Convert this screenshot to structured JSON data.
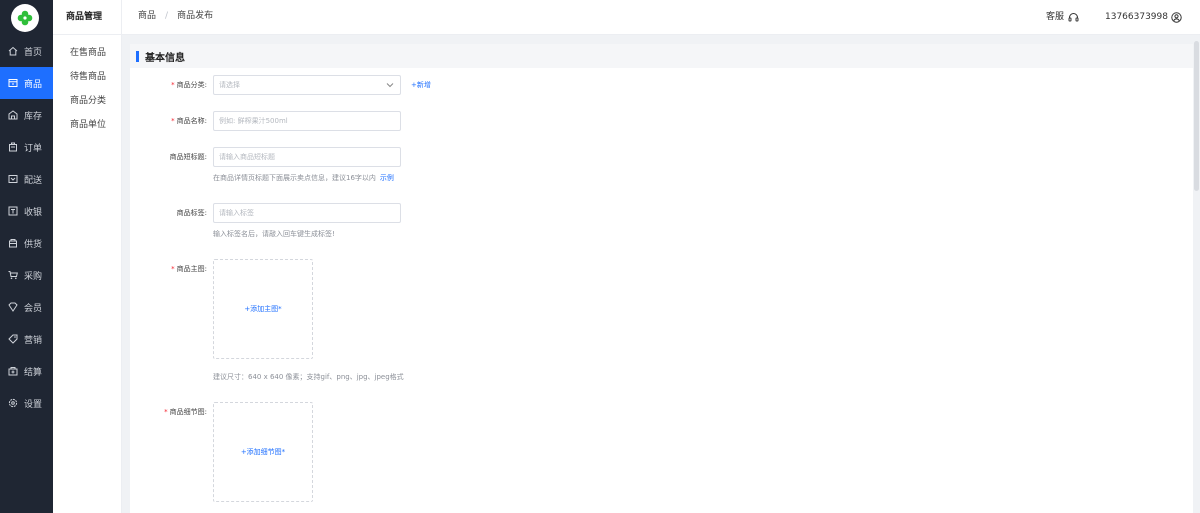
{
  "sidebar": {
    "items": [
      {
        "label": "首页",
        "icon": "home-icon"
      },
      {
        "label": "商品",
        "icon": "goods-icon",
        "active": true
      },
      {
        "label": "库存",
        "icon": "warehouse-icon"
      },
      {
        "label": "订单",
        "icon": "order-icon"
      },
      {
        "label": "配送",
        "icon": "delivery-icon"
      },
      {
        "label": "收银",
        "icon": "cashier-icon"
      },
      {
        "label": "供货",
        "icon": "supply-icon"
      },
      {
        "label": "采购",
        "icon": "cart-icon"
      },
      {
        "label": "会员",
        "icon": "member-icon"
      },
      {
        "label": "营销",
        "icon": "tag-icon"
      },
      {
        "label": "结算",
        "icon": "settlement-icon"
      },
      {
        "label": "设置",
        "icon": "gear-icon"
      }
    ]
  },
  "submenu": {
    "title": "商品管理",
    "items": [
      "在售商品",
      "待售商品",
      "商品分类",
      "商品单位"
    ]
  },
  "header": {
    "breadcrumb": [
      "商品",
      "商品发布"
    ],
    "service_label": "客服",
    "phone": "13766373998"
  },
  "form": {
    "section_title": "基本信息",
    "category": {
      "label": "商品分类:",
      "placeholder": "请选择",
      "add_link": "+新增"
    },
    "name": {
      "label": "商品名称:",
      "placeholder": "例如: 鲜榨果汁500ml"
    },
    "short_title": {
      "label": "商品短标题:",
      "placeholder": "请输入商品短标题",
      "hint": "在商品详情页标题下面展示卖点信息，建议16字以内",
      "hint_link": "示例"
    },
    "tags": {
      "label": "商品标签:",
      "placeholder": "请输入标签",
      "hint": "输入标签名后，请敲入回车键生成标签!"
    },
    "main_image": {
      "label": "商品主图:",
      "upload_text": "+添加主图*",
      "hint": "建议尺寸：640 x 640 像素；支持gif、png、jpg、jpeg格式"
    },
    "detail_image": {
      "label": "商品细节图:",
      "upload_text": "+添加细节图*"
    }
  },
  "colors": {
    "accent": "#1e6fff",
    "sidebar_bg": "#1f2633",
    "required": "#f5222d"
  }
}
